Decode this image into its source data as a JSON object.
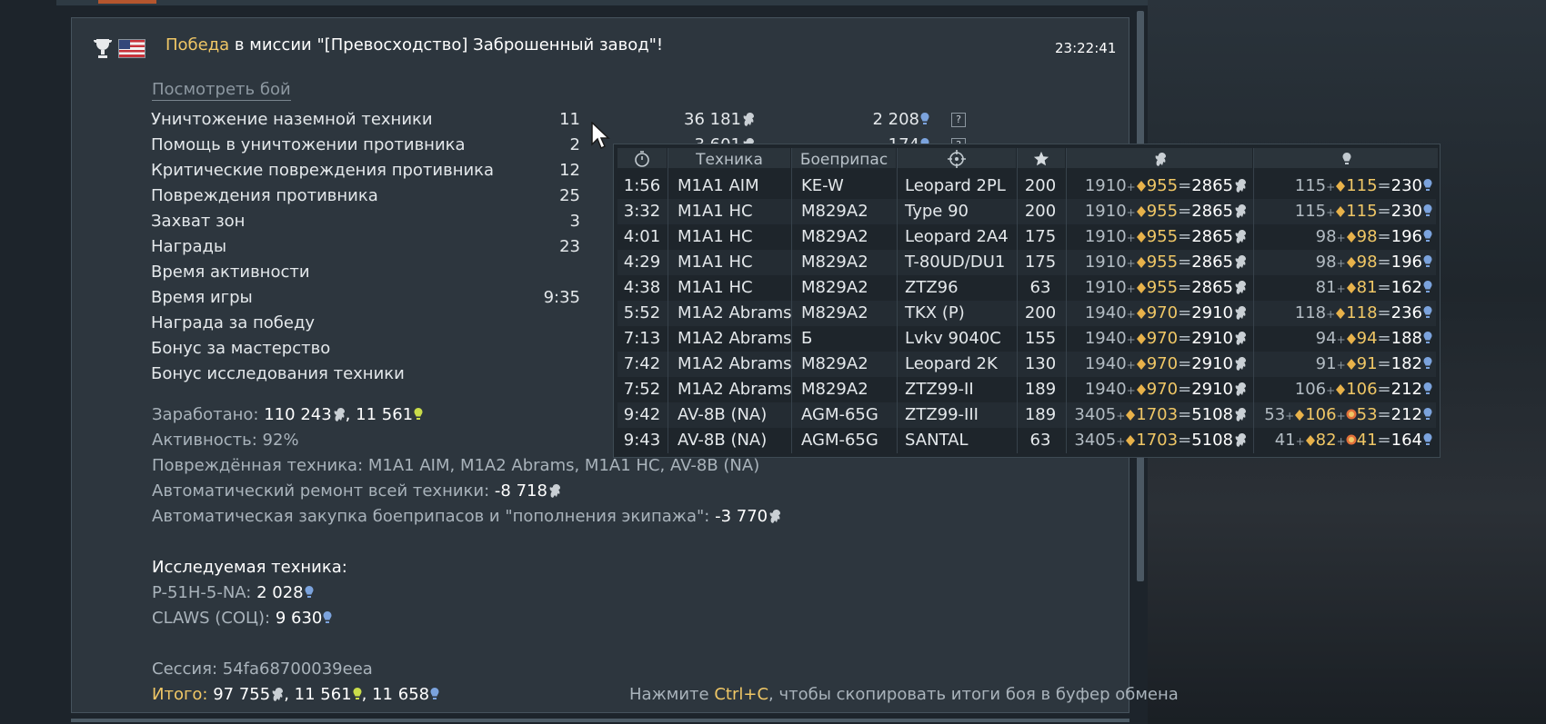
{
  "battle": {
    "result_word": "Победа",
    "mission_text": " в миссии \"[Превосходство] Заброшенный завод\"!",
    "time": "23:22:41",
    "watch_link": "Посмотреть бой"
  },
  "stats": [
    {
      "label": "Уничтожение наземной техники",
      "count": "11",
      "lions": "36 181",
      "rp": "2 208",
      "has_help": true
    },
    {
      "label": "Помощь в уничтожении противника",
      "count": "2",
      "lions": "3 601",
      "rp": "174",
      "has_help": true
    },
    {
      "label": "Критические повреждения противника",
      "count": "12",
      "lions": "",
      "rp": "",
      "has_help": false
    },
    {
      "label": "Повреждения противника",
      "count": "25",
      "lions": "",
      "rp": "",
      "has_help": false
    },
    {
      "label": "Захват зон",
      "count": "3",
      "lions": "",
      "rp": "",
      "has_help": false
    },
    {
      "label": "Награды",
      "count": "23",
      "lions": "",
      "rp": "",
      "has_help": false
    },
    {
      "label": "Время активности",
      "count": "",
      "lions": "",
      "rp": "",
      "has_help": false
    },
    {
      "label": "Время игры",
      "count": "9:35",
      "lions": "",
      "rp": "",
      "has_help": false
    },
    {
      "label": "Награда за победу",
      "count": "",
      "lions": "",
      "rp": "",
      "has_help": false
    },
    {
      "label": "Бонус за мастерство",
      "count": "",
      "lions": "",
      "rp": "",
      "has_help": false
    },
    {
      "label": "Бонус исследования техники",
      "count": "",
      "lions": "",
      "rp": "",
      "has_help": false
    }
  ],
  "summary": {
    "earned_label": "Заработано: ",
    "earned_lions": "110 243",
    "earned_sep": ", ",
    "earned_rp": "11 561",
    "activity": "Активность: 92%",
    "damaged": "Повреждённая техника: M1A1 AIM, M1A2 Abrams, M1A1 HC, AV-8B (NA)",
    "repair_label": "Автоматический ремонт всей техники: ",
    "repair_value": "-8 718",
    "ammo_label": "Автоматическая закупка боеприпасов и \"пополнения экипажа\": ",
    "ammo_value": "-3 770",
    "research_title": "Исследуемая техника:",
    "research": [
      {
        "label": "P-51H-5-NA: ",
        "value": "2 028"
      },
      {
        "label": "CLAWS (СОЦ): ",
        "value": "9 630"
      }
    ],
    "session": "Сессия: 54fa68700039eea",
    "total_label": "Итого:",
    "total_lions": " 97 755",
    "total_rp1": "11 561",
    "total_rp2": "11 658",
    "sep": ", ",
    "hint_pre": "Нажмите ",
    "hint_key": "Ctrl+C",
    "hint_post": ", чтобы скопировать итоги боя в буфер обмена"
  },
  "popup": {
    "headers": {
      "vehicle": "Техника",
      "ammo": "Боеприпас"
    },
    "rows": [
      {
        "time": "1:56",
        "veh": "M1A1 AIM",
        "ammo": "KE-W",
        "target": "Leopard 2PL",
        "score": "200",
        "sl_base": "1910",
        "sl_bonus": "955",
        "sl_total": "2865",
        "rp_base": "115",
        "rp_bonus": "115",
        "rp_extra": "",
        "rp_total": "230"
      },
      {
        "time": "3:32",
        "veh": "M1A1 HC",
        "ammo": "M829A2",
        "target": "Type 90",
        "score": "200",
        "sl_base": "1910",
        "sl_bonus": "955",
        "sl_total": "2865",
        "rp_base": "115",
        "rp_bonus": "115",
        "rp_extra": "",
        "rp_total": "230"
      },
      {
        "time": "4:01",
        "veh": "M1A1 HC",
        "ammo": "M829A2",
        "target": "Leopard 2A4",
        "score": "175",
        "sl_base": "1910",
        "sl_bonus": "955",
        "sl_total": "2865",
        "rp_base": "98",
        "rp_bonus": "98",
        "rp_extra": "",
        "rp_total": "196"
      },
      {
        "time": "4:29",
        "veh": "M1A1 HC",
        "ammo": "M829A2",
        "target": "T-80UD/DU1",
        "score": "175",
        "sl_base": "1910",
        "sl_bonus": "955",
        "sl_total": "2865",
        "rp_base": "98",
        "rp_bonus": "98",
        "rp_extra": "",
        "rp_total": "196"
      },
      {
        "time": "4:38",
        "veh": "M1A1 HC",
        "ammo": "M829A2",
        "target": "ZTZ96",
        "score": "63",
        "sl_base": "1910",
        "sl_bonus": "955",
        "sl_total": "2865",
        "rp_base": "81",
        "rp_bonus": "81",
        "rp_extra": "",
        "rp_total": "162"
      },
      {
        "time": "5:52",
        "veh": "M1A2 Abrams",
        "ammo": "M829A2",
        "target": "TKX (P)",
        "score": "200",
        "sl_base": "1940",
        "sl_bonus": "970",
        "sl_total": "2910",
        "rp_base": "118",
        "rp_bonus": "118",
        "rp_extra": "",
        "rp_total": "236"
      },
      {
        "time": "7:13",
        "veh": "M1A2 Abrams",
        "ammo": "Б",
        "target": "Lvkv 9040C",
        "score": "155",
        "sl_base": "1940",
        "sl_bonus": "970",
        "sl_total": "2910",
        "rp_base": "94",
        "rp_bonus": "94",
        "rp_extra": "",
        "rp_total": "188"
      },
      {
        "time": "7:42",
        "veh": "M1A2 Abrams",
        "ammo": "M829A2",
        "target": "Leopard 2K",
        "score": "130",
        "sl_base": "1940",
        "sl_bonus": "970",
        "sl_total": "2910",
        "rp_base": "91",
        "rp_bonus": "91",
        "rp_extra": "",
        "rp_total": "182"
      },
      {
        "time": "7:52",
        "veh": "M1A2 Abrams",
        "ammo": "M829A2",
        "target": "ZTZ99-II",
        "score": "189",
        "sl_base": "1940",
        "sl_bonus": "970",
        "sl_total": "2910",
        "rp_base": "106",
        "rp_bonus": "106",
        "rp_extra": "",
        "rp_total": "212"
      },
      {
        "time": "9:42",
        "veh": "AV-8B (NA)",
        "ammo": "AGM-65G",
        "target": "ZTZ99-III",
        "score": "189",
        "sl_base": "3405",
        "sl_bonus": "1703",
        "sl_total": "5108",
        "rp_base": "53",
        "rp_bonus": "106",
        "rp_extra": "53",
        "rp_total": "212"
      },
      {
        "time": "9:43",
        "veh": "AV-8B (NA)",
        "ammo": "AGM-65G",
        "target": "SANTAL",
        "score": "63",
        "sl_base": "3405",
        "sl_bonus": "1703",
        "sl_total": "5108",
        "rp_base": "41",
        "rp_bonus": "82",
        "rp_extra": "41",
        "rp_total": "164"
      }
    ]
  },
  "icons": {
    "trophy": "trophy-icon",
    "flag": "usa-flag-icon",
    "lion": "silver-lions-icon",
    "rp": "research-points-icon",
    "timer": "timer-icon",
    "target": "crosshair-icon",
    "star": "star-icon",
    "cursor": "mouse-cursor-icon"
  },
  "colors": {
    "gold": "#f0c766",
    "rp_blue": "#7ba3dd",
    "free_rp": "#c9dc4a"
  }
}
